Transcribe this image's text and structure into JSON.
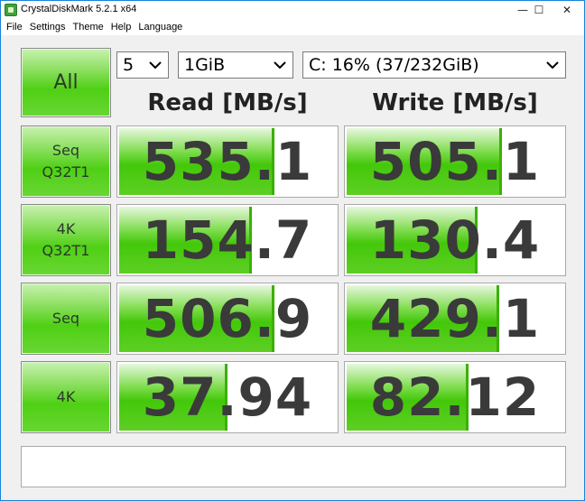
{
  "window": {
    "title": "CrystalDiskMark 5.2.1 x64",
    "controls": {
      "minimize": "—",
      "maximize": "☐",
      "close": "✕"
    }
  },
  "menu": [
    "File",
    "Settings",
    "Theme",
    "Help",
    "Language"
  ],
  "toolbar": {
    "all_label": "All",
    "count": "5",
    "size": "1GiB",
    "drive": "C: 16% (37/232GiB)"
  },
  "headers": {
    "read": "Read [MB/s]",
    "write": "Write [MB/s]"
  },
  "rows": [
    {
      "label": "Seq\nQ32T1",
      "read": "535.1",
      "write": "505.1",
      "read_fill": 0.72,
      "write_fill": 0.72
    },
    {
      "label": "4K\nQ32T1",
      "read": "154.7",
      "write": "130.4",
      "read_fill": 0.62,
      "write_fill": 0.61
    },
    {
      "label": "Seq",
      "read": "506.9",
      "write": "429.1",
      "read_fill": 0.72,
      "write_fill": 0.71
    },
    {
      "label": "4K",
      "read": "37.94",
      "write": "82.12",
      "read_fill": 0.51,
      "write_fill": 0.57
    }
  ],
  "colors": {
    "accent_green": "#43c80a",
    "title_border": "#1883d7"
  },
  "comment": ""
}
